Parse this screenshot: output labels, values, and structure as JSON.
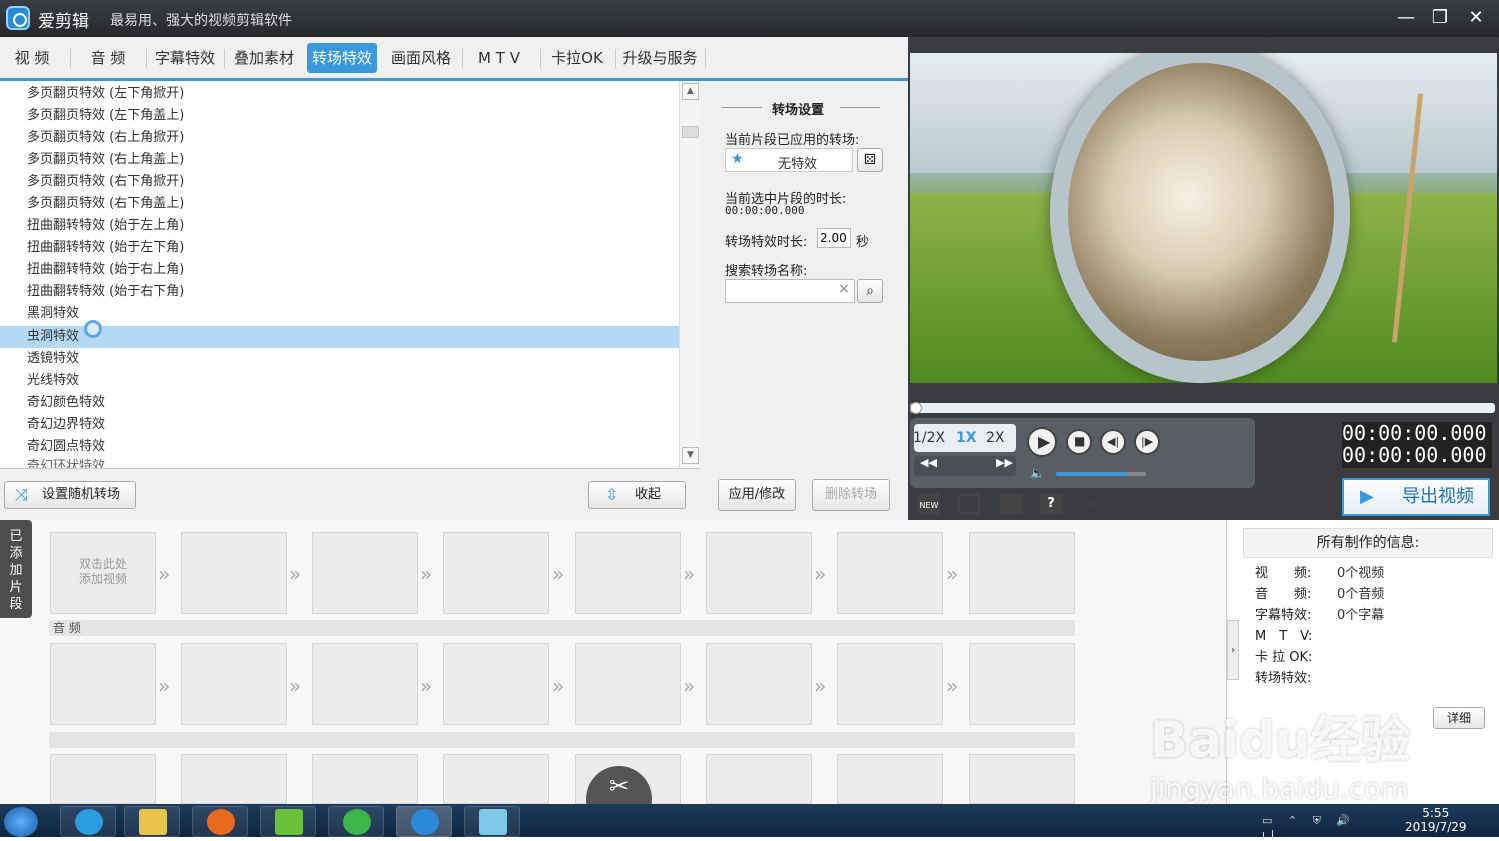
{
  "titlebar": {
    "app_name": "爱剪辑",
    "slogan": "最易用、强大的视频剪辑软件",
    "minimize_label": "—",
    "maximize_label": "❐",
    "close_label": "✕"
  },
  "tabs": [
    {
      "label": "视 频"
    },
    {
      "label": "音 频"
    },
    {
      "label": "字幕特效"
    },
    {
      "label": "叠加素材"
    },
    {
      "label": "转场特效",
      "active": true
    },
    {
      "label": "画面风格"
    },
    {
      "label": "M T V"
    },
    {
      "label": "卡拉OK"
    },
    {
      "label": "升级与服务"
    }
  ],
  "transition_list": {
    "items": [
      "多页翻页特效 (左下角掀开)",
      "多页翻页特效 (左下角盖上)",
      "多页翻页特效 (右上角掀开)",
      "多页翻页特效 (右上角盖上)",
      "多页翻页特效 (右下角掀开)",
      "多页翻页特效 (右下角盖上)",
      "扭曲翻转特效 (始于左上角)",
      "扭曲翻转特效 (始于左下角)",
      "扭曲翻转特效 (始于右上角)",
      "扭曲翻转特效 (始于右下角)",
      "黑洞特效",
      "虫洞特效",
      "透镜特效",
      "光线特效",
      "奇幻颜色特效",
      "奇幻边界特效",
      "奇幻圆点特效",
      "奇幻环状特效"
    ],
    "selected_index": 11,
    "random_button": "设置随机转场",
    "collapse_button": "收起"
  },
  "settings": {
    "title": "转场设置",
    "applied_label": "当前片段已应用的转场:",
    "applied_value": "无特效",
    "duration_label": "当前选中片段的时长:",
    "duration_value": "00:00:00.000",
    "effect_duration_label": "转场特效时长:",
    "effect_duration_value": "2.00",
    "effect_duration_unit": "秒",
    "search_label": "搜索转场名称:",
    "search_value": "",
    "apply_button": "应用/修改",
    "delete_button": "删除转场"
  },
  "player": {
    "speed_options": [
      "1/2X",
      "1X",
      "2X"
    ],
    "active_speed": "1X",
    "time_current": "00:00:00.000",
    "time_total": "00:00:00.000",
    "volume": 0.8,
    "export_label": "导出视频"
  },
  "timeline": {
    "side_tab": "已添加片段",
    "first_clip_hint": "双击此处\n添加视频",
    "audio_band_label": "音 频",
    "clip_count": 8
  },
  "info": {
    "header": "所有制作的信息:",
    "rows": [
      {
        "label": "视　　频:",
        "value": "0个视频"
      },
      {
        "label": "音　　频:",
        "value": "0个音频"
      },
      {
        "label": "字幕特效:",
        "value": "0个字幕"
      },
      {
        "label": "M　T　V:",
        "value": ""
      },
      {
        "label": "卡 拉 OK:",
        "value": ""
      },
      {
        "label": "转场特效:",
        "value": ""
      }
    ],
    "detail_button": "详细"
  },
  "taskbar": {
    "time": "5:55",
    "date": "2019/7/29"
  },
  "watermark": {
    "line1": "Baidu经验",
    "line2": "jingyan.baidu.com"
  }
}
